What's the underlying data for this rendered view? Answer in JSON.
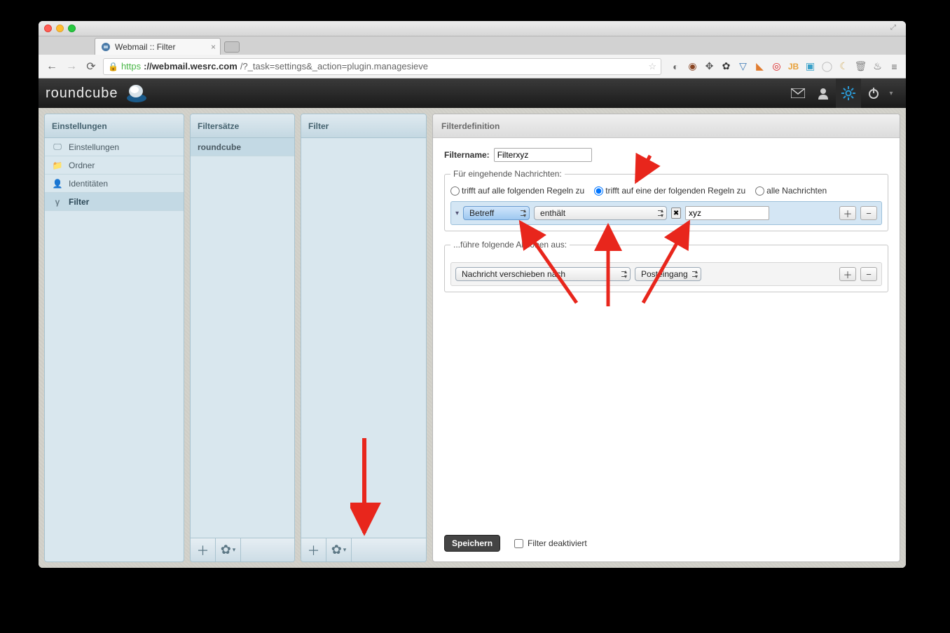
{
  "browser": {
    "tab_title": "Webmail :: Filter",
    "url_https": "https",
    "url_host": "://webmail.wesrc.com",
    "url_path": "/?_task=settings&_action=plugin.managesieve"
  },
  "logo": "roundcube",
  "panels": {
    "settings_title": "Einstellungen",
    "settings_items": [
      {
        "icon": "monitor-icon",
        "label": "Einstellungen"
      },
      {
        "icon": "folder-icon",
        "label": "Ordner"
      },
      {
        "icon": "person-icon",
        "label": "Identitäten"
      },
      {
        "icon": "filter-icon",
        "label": "Filter"
      }
    ],
    "filtersets_title": "Filtersätze",
    "filtersets": [
      "roundcube"
    ],
    "filters_title": "Filter",
    "main_title": "Filterdefinition"
  },
  "form": {
    "name_label": "Filtername:",
    "name_value": "Filterxyz",
    "rules_legend": "Für eingehende Nachrichten:",
    "radio_all": "trifft auf alle folgenden Regeln zu",
    "radio_any": "trifft auf eine der folgenden Regeln zu",
    "radio_every": "alle Nachrichten",
    "rule_header": "Betreff",
    "rule_op": "enthält",
    "rule_value": "xyz",
    "actions_legend": "...führe folgende Aktionen aus:",
    "action_type": "Nachricht verschieben nach",
    "action_target": "Posteingang",
    "save": "Speichern",
    "disabled": "Filter deaktiviert"
  }
}
